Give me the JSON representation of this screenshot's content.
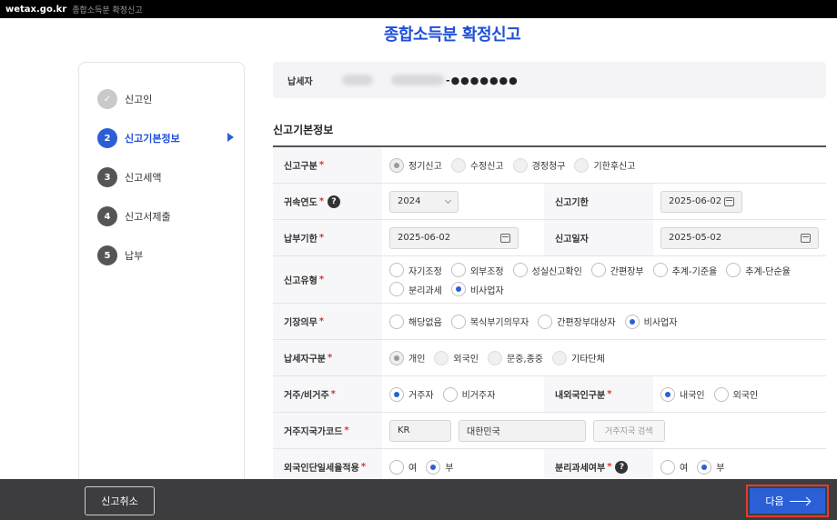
{
  "browser": {
    "site": "wetax.go.kr",
    "crumb": "종합소득분 확정신고"
  },
  "page": {
    "title": "종합소득분 확정신고"
  },
  "steps": [
    {
      "num": "✓",
      "label": "신고인",
      "state": "done"
    },
    {
      "num": "2",
      "label": "신고기본정보",
      "state": "active"
    },
    {
      "num": "3",
      "label": "신고세액",
      "state": "todo"
    },
    {
      "num": "4",
      "label": "신고서제출",
      "state": "todo"
    },
    {
      "num": "5",
      "label": "납부",
      "state": "todo"
    }
  ],
  "taxpayer": {
    "label": "납세자",
    "masked": "-●●●●●●●"
  },
  "section": {
    "title": "신고기본정보"
  },
  "form": {
    "report_type": {
      "label": "신고구분",
      "options": [
        "정기신고",
        "수정신고",
        "경정청구",
        "기한후신고"
      ]
    },
    "attribution_year": {
      "label": "귀속연도",
      "value": "2024"
    },
    "report_deadline": {
      "label": "신고기한",
      "value": "2025-06-02"
    },
    "payment_deadline": {
      "label": "납부기한",
      "value": "2025-06-02"
    },
    "report_date": {
      "label": "신고일자",
      "value": "2025-05-02"
    },
    "report_category": {
      "label": "신고유형",
      "options": [
        "자기조정",
        "외부조정",
        "성실신고확인",
        "간편장부",
        "추계-기준율",
        "추계-단순율",
        "분리과세",
        "비사업자"
      ]
    },
    "bookkeeping": {
      "label": "기장의무",
      "options": [
        "해당없음",
        "복식부기의무자",
        "간편장부대상자",
        "비사업자"
      ]
    },
    "taxpayer_type": {
      "label": "납세자구분",
      "options": [
        "개인",
        "외국인",
        "문중,종중",
        "기타단체"
      ]
    },
    "residency": {
      "label": "거주/비거주",
      "options": [
        "거주자",
        "비거주자"
      ]
    },
    "nationality": {
      "label": "내외국인구분",
      "options": [
        "내국인",
        "외국인"
      ]
    },
    "country_code": {
      "label": "거주지국가코드",
      "code": "KR",
      "name": "대한민국",
      "search_button": "거주지국 검색"
    },
    "foreigner_flat_rate": {
      "label": "외국인단일세율적용",
      "options": [
        "여",
        "부"
      ]
    },
    "separate_tax": {
      "label": "분리과세여부",
      "options": [
        "여",
        "부"
      ]
    }
  },
  "footer": {
    "cancel": "신고취소",
    "next": "다음"
  },
  "colors": {
    "accent": "#2c5fd6",
    "title": "#1f4fd8",
    "highlight": "#e43b2f",
    "required": "#e03030",
    "footer": "#3d3d3f"
  }
}
